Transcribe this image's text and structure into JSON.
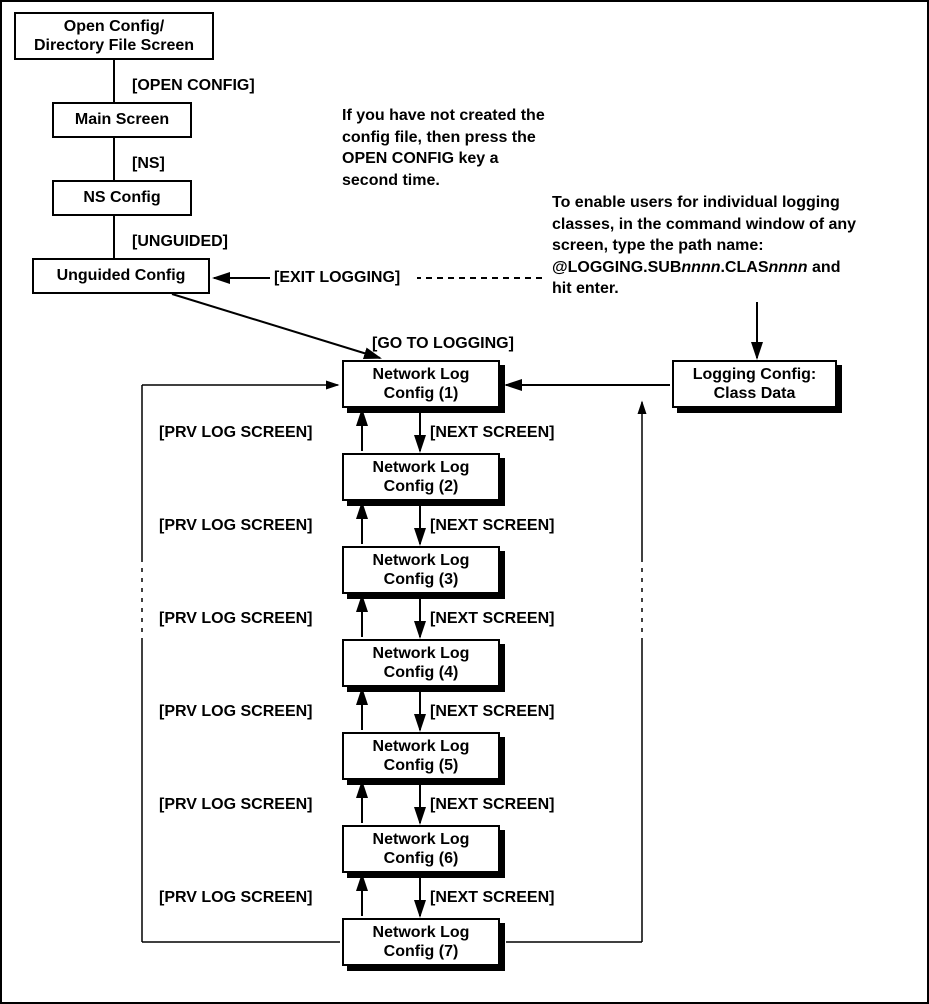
{
  "boxes": {
    "open_config": "Open Config/\nDirectory File Screen",
    "main_screen": "Main Screen",
    "ns_config": "NS Config",
    "unguided_config": "Unguided Config",
    "net_log_1": "Network Log\nConfig (1)",
    "net_log_2": "Network Log\nConfig (2)",
    "net_log_3": "Network Log\nConfig (3)",
    "net_log_4": "Network Log\nConfig (4)",
    "net_log_5": "Network Log\nConfig (5)",
    "net_log_6": "Network Log\nConfig (6)",
    "net_log_7": "Network Log\nConfig (7)",
    "logging_class": "Logging Config:\nClass Data"
  },
  "labels": {
    "open_config_key": "[OPEN CONFIG]",
    "ns_key": "[NS]",
    "unguided_key": "[UNGUIDED]",
    "exit_logging": "[EXIT LOGGING]",
    "go_to_logging": "[GO TO LOGGING]",
    "next_screen": "[NEXT SCREEN]",
    "prv_log_screen": "[PRV LOG SCREEN]"
  },
  "notes": {
    "open_config_note": "If you have not created the\nconfig file, then press the\nOPEN CONFIG key a\nsecond time.",
    "logging_path_pre": "To enable users for individual logging\nclasses, in the command window of any\nscreen, type the path name:\n@LOGGING.SUB",
    "logging_path_n1": "nnnn",
    "logging_path_mid": ".CLAS",
    "logging_path_n2": "nnnn",
    "logging_path_post": " and\nhit enter."
  }
}
